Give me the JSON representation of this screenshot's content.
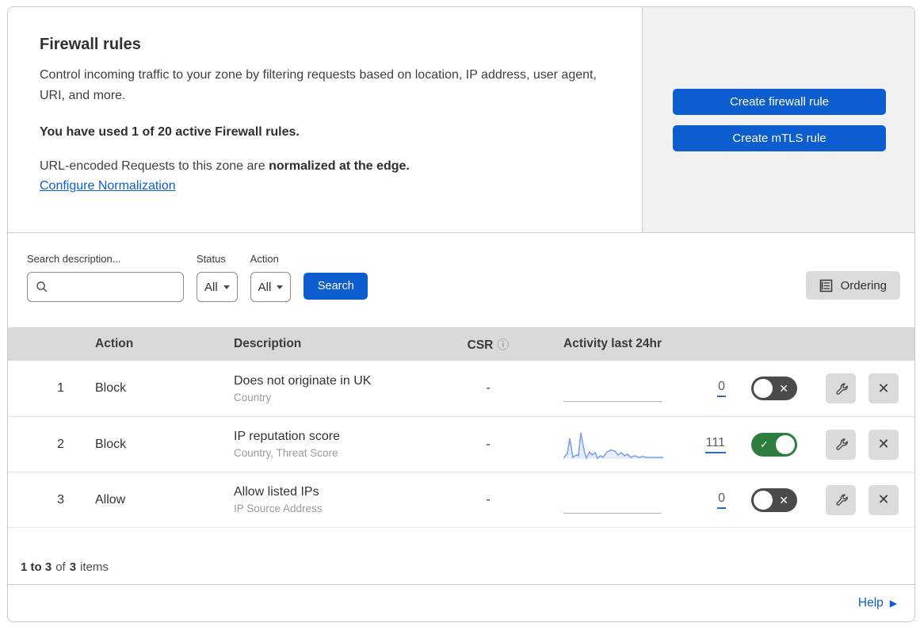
{
  "header": {
    "title": "Firewall rules",
    "description": "Control incoming traffic to your zone by filtering requests based on location, IP address, user agent, URI, and more.",
    "usage_text": "You have used 1 of 20 active Firewall rules.",
    "normalization_prefix": "URL-encoded Requests to this zone are ",
    "normalization_bold": "normalized at the edge.",
    "normalization_link": "Configure Normalization"
  },
  "actions_panel": {
    "create_firewall_rule_label": "Create firewall rule",
    "create_mtls_rule_label": "Create mTLS rule"
  },
  "filters": {
    "search_label": "Search description...",
    "search_value": "",
    "status_label": "Status",
    "status_value": "All",
    "action_label": "Action",
    "action_value": "All",
    "search_button_label": "Search",
    "ordering_button_label": "Ordering"
  },
  "table": {
    "columns": {
      "action": "Action",
      "description": "Description",
      "csr": "CSR",
      "activity": "Activity last 24hr"
    },
    "rows": [
      {
        "number": "1",
        "action": "Block",
        "description": "Does not originate in UK",
        "criteria": "Country",
        "csr": "-",
        "activity_count": "0",
        "enabled": false,
        "sparkline": []
      },
      {
        "number": "2",
        "action": "Block",
        "description": "IP reputation score",
        "criteria": "Country, Threat Score",
        "csr": "-",
        "activity_count": "111",
        "enabled": true,
        "sparkline": [
          [
            0,
            37
          ],
          [
            5,
            31
          ],
          [
            8,
            12
          ],
          [
            12,
            36
          ],
          [
            16,
            33
          ],
          [
            19,
            34
          ],
          [
            22,
            5
          ],
          [
            26,
            27
          ],
          [
            29,
            37
          ],
          [
            33,
            29
          ],
          [
            36,
            33
          ],
          [
            40,
            30
          ],
          [
            43,
            37
          ],
          [
            47,
            34
          ],
          [
            50,
            36
          ],
          [
            55,
            29
          ],
          [
            60,
            27
          ],
          [
            65,
            28
          ],
          [
            69,
            33
          ],
          [
            73,
            30
          ],
          [
            77,
            34
          ],
          [
            81,
            32
          ],
          [
            85,
            36
          ],
          [
            90,
            34
          ],
          [
            95,
            36
          ],
          [
            100,
            35
          ],
          [
            105,
            36
          ],
          [
            110,
            36
          ],
          [
            116,
            36
          ],
          [
            121,
            36
          ],
          [
            126,
            36
          ]
        ]
      },
      {
        "number": "3",
        "action": "Allow",
        "description": "Allow listed IPs",
        "criteria": "IP Source Address",
        "csr": "-",
        "activity_count": "0",
        "enabled": false,
        "sparkline": []
      }
    ]
  },
  "footer": {
    "range_bold": "1 to 3",
    "of_text": "of",
    "total_bold": "3",
    "items_text": "items",
    "help_label": "Help"
  },
  "icons": {
    "info": "ⓘ",
    "close_x": "✕",
    "check": "✓",
    "help_arrow": "▶"
  },
  "colors": {
    "accent_blue": "#0b5dd0",
    "toggle_on_green": "#2e7d40",
    "toggle_off_gray": "#4a4a4c",
    "sparkline_blue": "#7aa3e6",
    "header_band_gray": "#d9d9d9",
    "panel_gray": "#f1f1f2"
  }
}
